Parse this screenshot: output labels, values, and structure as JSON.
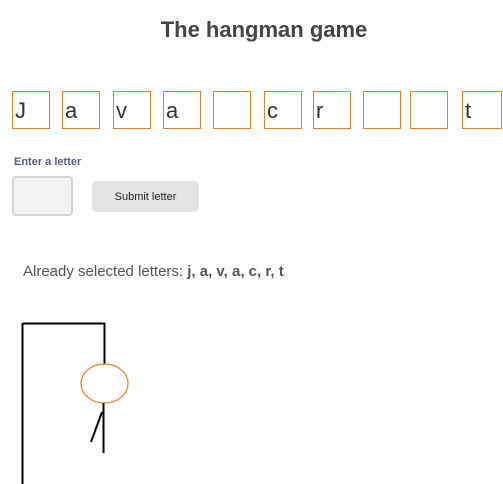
{
  "title": "The hangman game",
  "word_slots": [
    {
      "letter": "J"
    },
    {
      "letter": "a"
    },
    {
      "letter": "v"
    },
    {
      "letter": "a"
    },
    {
      "letter": ""
    },
    {
      "letter": "c"
    },
    {
      "letter": "r"
    },
    {
      "letter": ""
    },
    {
      "letter": ""
    },
    {
      "letter": "t"
    }
  ],
  "input": {
    "label": "Enter a letter",
    "value": "",
    "submit_label": "Submit letter"
  },
  "selected": {
    "prefix": "Already selected letters:",
    "letters": "j, a, v, a, c, r, t"
  },
  "colors": {
    "slot_border": "#e0842c",
    "head_stroke": "#e0842c",
    "gallows_stroke": "#000000"
  },
  "hangman": {
    "parts_shown": [
      "head",
      "body",
      "left-arm"
    ]
  }
}
